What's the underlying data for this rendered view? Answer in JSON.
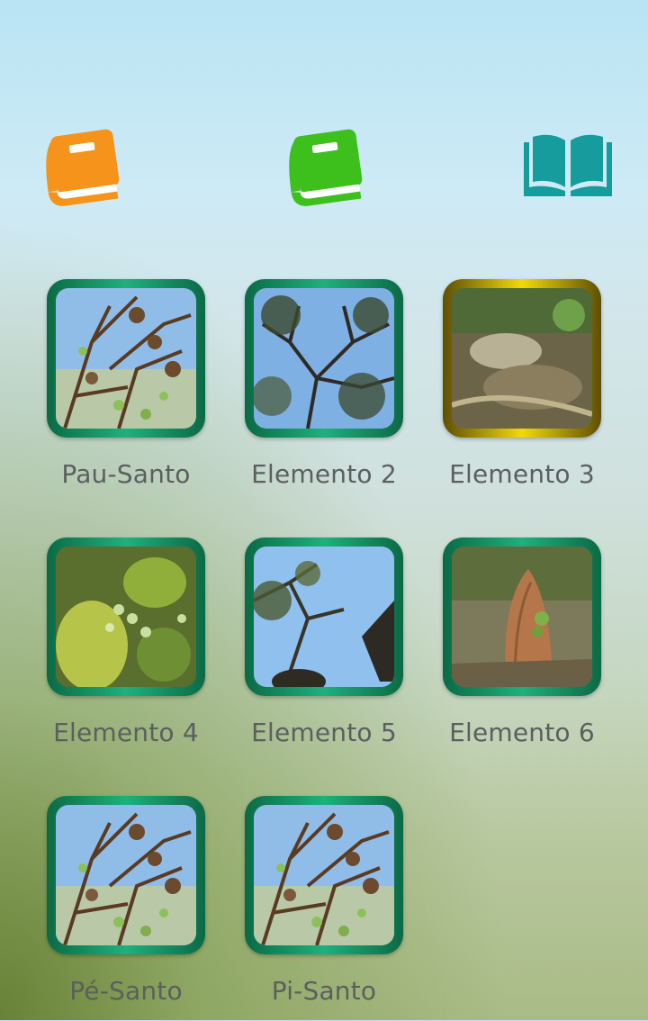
{
  "toolbar": {
    "buttons": [
      {
        "icon": "closed-book-icon",
        "color": "#f6931a"
      },
      {
        "icon": "closed-book-icon",
        "color": "#3dbf1c"
      },
      {
        "icon": "open-book-icon",
        "color": "#169c9c"
      }
    ]
  },
  "grid": {
    "items": [
      {
        "label": "Pau-Santo",
        "border": "green",
        "photo": "branches-with-seed-pods"
      },
      {
        "label": "Elemento 2",
        "border": "green",
        "photo": "tree-canopy-against-sky"
      },
      {
        "label": "Elemento 3",
        "border": "gold",
        "photo": "forest-floor-stream"
      },
      {
        "label": "Elemento 4",
        "border": "green",
        "photo": "green-leaves-and-buds"
      },
      {
        "label": "Elemento 5",
        "border": "green",
        "photo": "branch-against-sky"
      },
      {
        "label": "Elemento 6",
        "border": "green",
        "photo": "termite-mound"
      },
      {
        "label": "Pé-Santo",
        "border": "green",
        "photo": "branches-with-seed-pods"
      },
      {
        "label": "Pi-Santo",
        "border": "green",
        "photo": "branches-with-seed-pods"
      }
    ]
  },
  "colors": {
    "tile_border_green": "#1fb07d",
    "tile_border_gold": "#f2d90a",
    "caption_text": "#5b5f5f"
  }
}
